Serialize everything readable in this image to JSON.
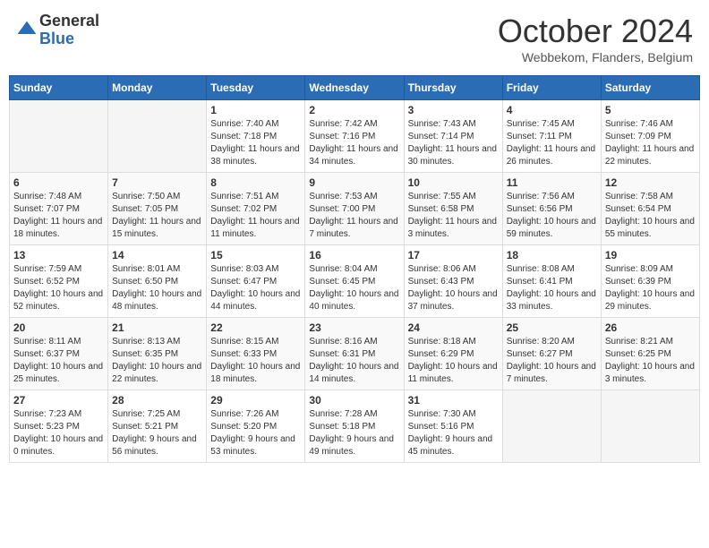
{
  "logo": {
    "general": "General",
    "blue": "Blue"
  },
  "header": {
    "month": "October 2024",
    "location": "Webbekom, Flanders, Belgium"
  },
  "weekdays": [
    "Sunday",
    "Monday",
    "Tuesday",
    "Wednesday",
    "Thursday",
    "Friday",
    "Saturday"
  ],
  "weeks": [
    [
      {
        "day": "",
        "sunrise": "",
        "sunset": "",
        "daylight": ""
      },
      {
        "day": "",
        "sunrise": "",
        "sunset": "",
        "daylight": ""
      },
      {
        "day": "1",
        "sunrise": "Sunrise: 7:40 AM",
        "sunset": "Sunset: 7:18 PM",
        "daylight": "Daylight: 11 hours and 38 minutes."
      },
      {
        "day": "2",
        "sunrise": "Sunrise: 7:42 AM",
        "sunset": "Sunset: 7:16 PM",
        "daylight": "Daylight: 11 hours and 34 minutes."
      },
      {
        "day": "3",
        "sunrise": "Sunrise: 7:43 AM",
        "sunset": "Sunset: 7:14 PM",
        "daylight": "Daylight: 11 hours and 30 minutes."
      },
      {
        "day": "4",
        "sunrise": "Sunrise: 7:45 AM",
        "sunset": "Sunset: 7:11 PM",
        "daylight": "Daylight: 11 hours and 26 minutes."
      },
      {
        "day": "5",
        "sunrise": "Sunrise: 7:46 AM",
        "sunset": "Sunset: 7:09 PM",
        "daylight": "Daylight: 11 hours and 22 minutes."
      }
    ],
    [
      {
        "day": "6",
        "sunrise": "Sunrise: 7:48 AM",
        "sunset": "Sunset: 7:07 PM",
        "daylight": "Daylight: 11 hours and 18 minutes."
      },
      {
        "day": "7",
        "sunrise": "Sunrise: 7:50 AM",
        "sunset": "Sunset: 7:05 PM",
        "daylight": "Daylight: 11 hours and 15 minutes."
      },
      {
        "day": "8",
        "sunrise": "Sunrise: 7:51 AM",
        "sunset": "Sunset: 7:02 PM",
        "daylight": "Daylight: 11 hours and 11 minutes."
      },
      {
        "day": "9",
        "sunrise": "Sunrise: 7:53 AM",
        "sunset": "Sunset: 7:00 PM",
        "daylight": "Daylight: 11 hours and 7 minutes."
      },
      {
        "day": "10",
        "sunrise": "Sunrise: 7:55 AM",
        "sunset": "Sunset: 6:58 PM",
        "daylight": "Daylight: 11 hours and 3 minutes."
      },
      {
        "day": "11",
        "sunrise": "Sunrise: 7:56 AM",
        "sunset": "Sunset: 6:56 PM",
        "daylight": "Daylight: 10 hours and 59 minutes."
      },
      {
        "day": "12",
        "sunrise": "Sunrise: 7:58 AM",
        "sunset": "Sunset: 6:54 PM",
        "daylight": "Daylight: 10 hours and 55 minutes."
      }
    ],
    [
      {
        "day": "13",
        "sunrise": "Sunrise: 7:59 AM",
        "sunset": "Sunset: 6:52 PM",
        "daylight": "Daylight: 10 hours and 52 minutes."
      },
      {
        "day": "14",
        "sunrise": "Sunrise: 8:01 AM",
        "sunset": "Sunset: 6:50 PM",
        "daylight": "Daylight: 10 hours and 48 minutes."
      },
      {
        "day": "15",
        "sunrise": "Sunrise: 8:03 AM",
        "sunset": "Sunset: 6:47 PM",
        "daylight": "Daylight: 10 hours and 44 minutes."
      },
      {
        "day": "16",
        "sunrise": "Sunrise: 8:04 AM",
        "sunset": "Sunset: 6:45 PM",
        "daylight": "Daylight: 10 hours and 40 minutes."
      },
      {
        "day": "17",
        "sunrise": "Sunrise: 8:06 AM",
        "sunset": "Sunset: 6:43 PM",
        "daylight": "Daylight: 10 hours and 37 minutes."
      },
      {
        "day": "18",
        "sunrise": "Sunrise: 8:08 AM",
        "sunset": "Sunset: 6:41 PM",
        "daylight": "Daylight: 10 hours and 33 minutes."
      },
      {
        "day": "19",
        "sunrise": "Sunrise: 8:09 AM",
        "sunset": "Sunset: 6:39 PM",
        "daylight": "Daylight: 10 hours and 29 minutes."
      }
    ],
    [
      {
        "day": "20",
        "sunrise": "Sunrise: 8:11 AM",
        "sunset": "Sunset: 6:37 PM",
        "daylight": "Daylight: 10 hours and 25 minutes."
      },
      {
        "day": "21",
        "sunrise": "Sunrise: 8:13 AM",
        "sunset": "Sunset: 6:35 PM",
        "daylight": "Daylight: 10 hours and 22 minutes."
      },
      {
        "day": "22",
        "sunrise": "Sunrise: 8:15 AM",
        "sunset": "Sunset: 6:33 PM",
        "daylight": "Daylight: 10 hours and 18 minutes."
      },
      {
        "day": "23",
        "sunrise": "Sunrise: 8:16 AM",
        "sunset": "Sunset: 6:31 PM",
        "daylight": "Daylight: 10 hours and 14 minutes."
      },
      {
        "day": "24",
        "sunrise": "Sunrise: 8:18 AM",
        "sunset": "Sunset: 6:29 PM",
        "daylight": "Daylight: 10 hours and 11 minutes."
      },
      {
        "day": "25",
        "sunrise": "Sunrise: 8:20 AM",
        "sunset": "Sunset: 6:27 PM",
        "daylight": "Daylight: 10 hours and 7 minutes."
      },
      {
        "day": "26",
        "sunrise": "Sunrise: 8:21 AM",
        "sunset": "Sunset: 6:25 PM",
        "daylight": "Daylight: 10 hours and 3 minutes."
      }
    ],
    [
      {
        "day": "27",
        "sunrise": "Sunrise: 7:23 AM",
        "sunset": "Sunset: 5:23 PM",
        "daylight": "Daylight: 10 hours and 0 minutes."
      },
      {
        "day": "28",
        "sunrise": "Sunrise: 7:25 AM",
        "sunset": "Sunset: 5:21 PM",
        "daylight": "Daylight: 9 hours and 56 minutes."
      },
      {
        "day": "29",
        "sunrise": "Sunrise: 7:26 AM",
        "sunset": "Sunset: 5:20 PM",
        "daylight": "Daylight: 9 hours and 53 minutes."
      },
      {
        "day": "30",
        "sunrise": "Sunrise: 7:28 AM",
        "sunset": "Sunset: 5:18 PM",
        "daylight": "Daylight: 9 hours and 49 minutes."
      },
      {
        "day": "31",
        "sunrise": "Sunrise: 7:30 AM",
        "sunset": "Sunset: 5:16 PM",
        "daylight": "Daylight: 9 hours and 45 minutes."
      },
      {
        "day": "",
        "sunrise": "",
        "sunset": "",
        "daylight": ""
      },
      {
        "day": "",
        "sunrise": "",
        "sunset": "",
        "daylight": ""
      }
    ]
  ]
}
